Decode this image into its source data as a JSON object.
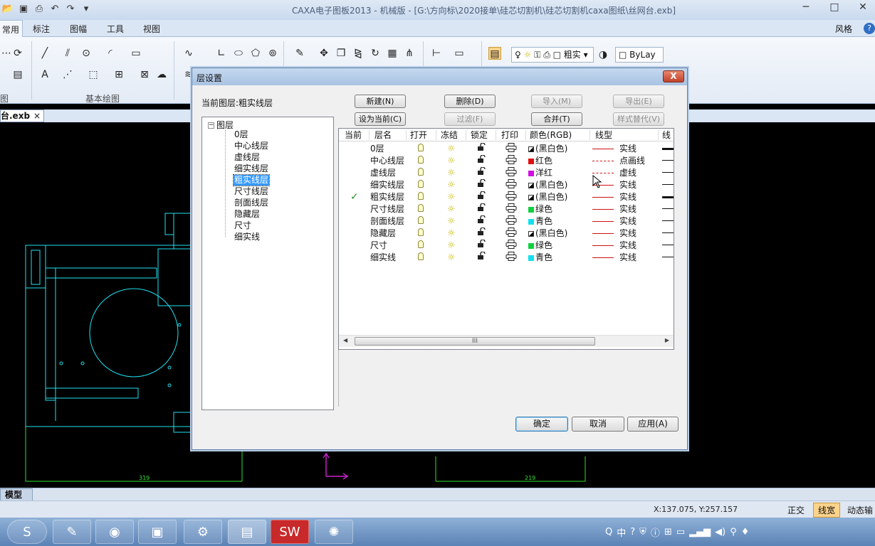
{
  "app": {
    "title": "CAXA电子图板2013 - 机械版 - [G:\\方向标\\2020接单\\硅芯切割机\\硅芯切割机caxa图纸\\丝网台.exb]",
    "style_menu": "风格",
    "help": "?"
  },
  "ribbon": {
    "tabs": [
      {
        "label": "常用",
        "active": true
      },
      {
        "label": "标注"
      },
      {
        "label": "图幅"
      },
      {
        "label": "工具"
      },
      {
        "label": "视图"
      }
    ],
    "group_left": "图",
    "group_basic_draw": "基本绘图",
    "linetype_combo": "粗实",
    "layer_combo": "ByLay",
    "text_tool": "A"
  },
  "doc_tab": {
    "label": "台.exb",
    "close": "×"
  },
  "model_tab": "模型",
  "status": {
    "coords": "X:137.075, Y:257.157",
    "ortho": "正交",
    "lineweight": "线宽",
    "dynamic": "动态输"
  },
  "canvas_dims": {
    "left": "319",
    "right": "219"
  },
  "dialog": {
    "title": "层设置",
    "close": "X",
    "current_layer_label": "当前图层:粗实线层",
    "buttons": {
      "new": "新建(N)",
      "delete": "删除(D)",
      "import": "导入(M)",
      "export": "导出(E)",
      "set_current": "设为当前(C)",
      "filter": "过滤(F)",
      "merge": "合并(T)",
      "style_replace": "样式替代(V)",
      "ok": "确定",
      "cancel": "取消",
      "apply": "应用(A)"
    },
    "tree": {
      "root": "图层",
      "items": [
        "0层",
        "中心线层",
        "虚线层",
        "细实线层",
        "粗实线层",
        "尺寸线层",
        "剖面线层",
        "隐藏层",
        "尺寸",
        "细实线"
      ],
      "selected": 4
    },
    "columns": {
      "current": "当前",
      "name": "层名",
      "on": "打开",
      "freeze": "冻结",
      "lock": "锁定",
      "print": "打印",
      "color": "颜色(RGB)",
      "linetype": "线型",
      "lineweight": "线"
    },
    "check_mark": "✓",
    "rows": [
      {
        "name": "0层",
        "color": "(黑白色)",
        "swatch": "bw",
        "linetype": "实线",
        "lw": "thick"
      },
      {
        "name": "中心线层",
        "color": "红色",
        "swatch": "#e01010",
        "linetype": "点画线",
        "lw": "thin",
        "dash": "dashdot"
      },
      {
        "name": "虚线层",
        "color": "洋红",
        "swatch": "#d010e0",
        "linetype": "虚线",
        "lw": "thin",
        "dash": "dash"
      },
      {
        "name": "细实线层",
        "color": "(黑白色)",
        "swatch": "bw",
        "linetype": "实线",
        "lw": "thin"
      },
      {
        "name": "粗实线层",
        "color": "(黑白色)",
        "swatch": "bw",
        "linetype": "实线",
        "lw": "thick",
        "current": true
      },
      {
        "name": "尺寸线层",
        "color": "绿色",
        "swatch": "#10d040",
        "linetype": "实线",
        "lw": "thin"
      },
      {
        "name": "剖面线层",
        "color": "青色",
        "swatch": "#10e0f0",
        "linetype": "实线",
        "lw": "thin"
      },
      {
        "name": "隐藏层",
        "color": "(黑白色)",
        "swatch": "bw",
        "linetype": "实线",
        "lw": "thin"
      },
      {
        "name": "尺寸",
        "color": "绿色",
        "swatch": "#10d040",
        "linetype": "实线",
        "lw": "thin"
      },
      {
        "name": "细实线",
        "color": "青色",
        "swatch": "#10e0f0",
        "linetype": "实线",
        "lw": "thin"
      }
    ],
    "scroll_thumb": "III"
  },
  "colors": {
    "accent": "#3399ff",
    "canvas": "#000000",
    "drawing": "#20e0f0",
    "dim": "#30e030"
  }
}
